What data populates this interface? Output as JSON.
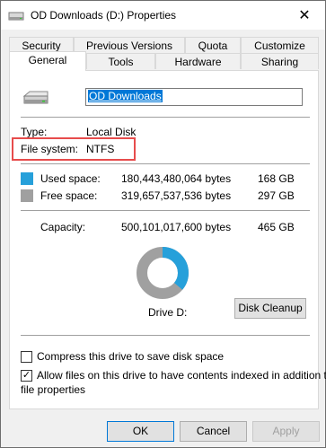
{
  "window": {
    "title": "OD Downloads  (D:) Properties",
    "close_glyph": "✕"
  },
  "tabs": {
    "row1": [
      "Security",
      "Previous Versions",
      "Quota",
      "Customize"
    ],
    "row2": [
      "General",
      "Tools",
      "Hardware",
      "Sharing"
    ],
    "active": "General"
  },
  "general": {
    "drive_name": "OD Downloads",
    "type_label": "Type:",
    "type_value": "Local Disk",
    "fs_label": "File system:",
    "fs_value": "NTFS",
    "used_label": "Used space:",
    "used_bytes": "180,443,480,064 bytes",
    "used_gb": "168 GB",
    "free_label": "Free space:",
    "free_bytes": "319,657,537,536 bytes",
    "free_gb": "297 GB",
    "capacity_label": "Capacity:",
    "capacity_bytes": "500,101,017,600 bytes",
    "capacity_gb": "465 GB",
    "drive_caption": "Drive D:",
    "disk_cleanup": "Disk Cleanup",
    "compress_label": "Compress this drive to save disk space",
    "compress_checked": false,
    "index_label_line1": "Allow files on this drive to have contents indexed in addition to",
    "index_label_line2": "file properties",
    "index_checked": true,
    "used_fraction": 0.361,
    "colors": {
      "used": "#26a0da",
      "free": "#a0a0a0",
      "highlight": "#e74c4c"
    }
  },
  "buttons": {
    "ok": "OK",
    "cancel": "Cancel",
    "apply": "Apply"
  }
}
